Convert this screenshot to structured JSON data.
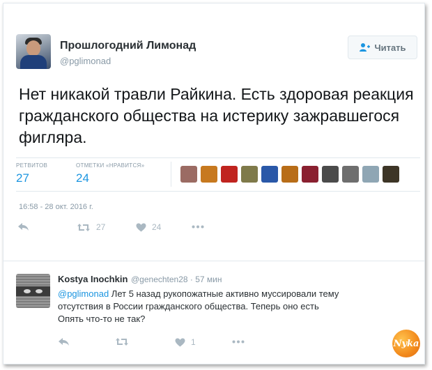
{
  "tweet": {
    "author_name": "Прошлогодний Лимонад",
    "author_handle": "@pglimonad",
    "follow_label": "Читать",
    "text": "Нет никакой травли Райкина. Есть здоровая реакция гражданского общества на истерику зажравшегося фигляра.",
    "stats": {
      "retweets_label": "РЕТВИТОВ",
      "retweets_count": "27",
      "likes_label": "ОТМЕТКИ «НРАВИТСЯ»",
      "likes_count": "24"
    },
    "likers": [
      {
        "icon": "liker-avatar",
        "color": "#9b6b63"
      },
      {
        "icon": "liker-avatar",
        "color": "#c7791f"
      },
      {
        "icon": "liker-avatar",
        "color": "#c0241f"
      },
      {
        "icon": "liker-avatar",
        "color": "#7f7a4a"
      },
      {
        "icon": "liker-avatar",
        "color": "#2a58a8"
      },
      {
        "icon": "liker-avatar",
        "color": "#b86d18"
      },
      {
        "icon": "liker-avatar",
        "color": "#8a2030"
      },
      {
        "icon": "liker-avatar",
        "color": "#4b4b4b"
      },
      {
        "icon": "liker-avatar",
        "color": "#6e6e6e"
      },
      {
        "icon": "liker-avatar",
        "color": "#8fa6b4"
      },
      {
        "icon": "liker-avatar",
        "color": "#3d3526"
      }
    ],
    "timestamp": "16:58 - 28 окт. 2016 г.",
    "actions": {
      "retweet_count": "27",
      "like_count": "24"
    }
  },
  "reply": {
    "author_name": "Kostya Inochkin",
    "meta": "@genechten28 · 57 мин",
    "mention": "@pglimonad",
    "text_line1": " Лет 5 назад рукопожатные активно муссировали тему",
    "text_line2": "отсутствия в России гражданского общества. Теперь оно есть",
    "text_line3": "Опять что-то не так?",
    "like_count": "1"
  },
  "watermark_text": "Nyka",
  "colors": {
    "link": "#1b95e0",
    "muted": "#8899a6",
    "icon": "#aab8c2"
  }
}
